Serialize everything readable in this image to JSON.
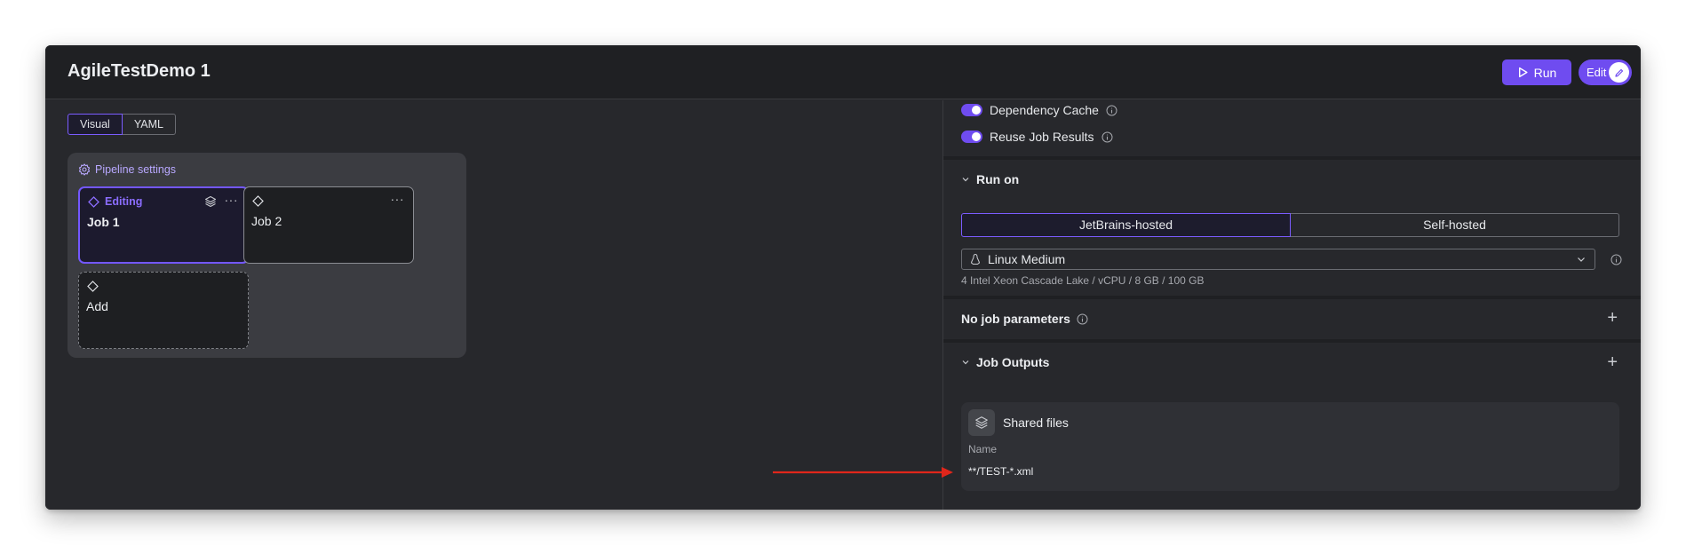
{
  "header": {
    "title": "AgileTestDemo 1",
    "run_label": "Run",
    "edit_label": "Edit"
  },
  "view_toggle": {
    "options": [
      "Visual",
      "YAML"
    ],
    "selected": "Visual"
  },
  "pipeline": {
    "settings_label": "Pipeline settings",
    "jobs": [
      {
        "name": "Job 1",
        "status": "Editing"
      },
      {
        "name": "Job 2"
      },
      {
        "name": "Add"
      }
    ]
  },
  "settings": {
    "dependency_cache_label": "Dependency Cache",
    "dependency_cache_on": true,
    "reuse_job_results_label": "Reuse Job Results",
    "reuse_job_results_on": true
  },
  "run_on": {
    "title": "Run on",
    "options": [
      "JetBrains-hosted",
      "Self-hosted"
    ],
    "selected": "JetBrains-hosted",
    "instance": "Linux Medium",
    "instance_spec": "4 Intel Xeon Cascade Lake / vCPU / 8 GB / 100 GB"
  },
  "job_parameters": {
    "title": "No job parameters"
  },
  "job_outputs": {
    "title": "Job Outputs",
    "card_title": "Shared files",
    "name_label": "Name",
    "name_value": "**/TEST-*.xml"
  },
  "colors": {
    "accent": "#6f4cf0",
    "annotation_arrow": "#e0261b"
  }
}
